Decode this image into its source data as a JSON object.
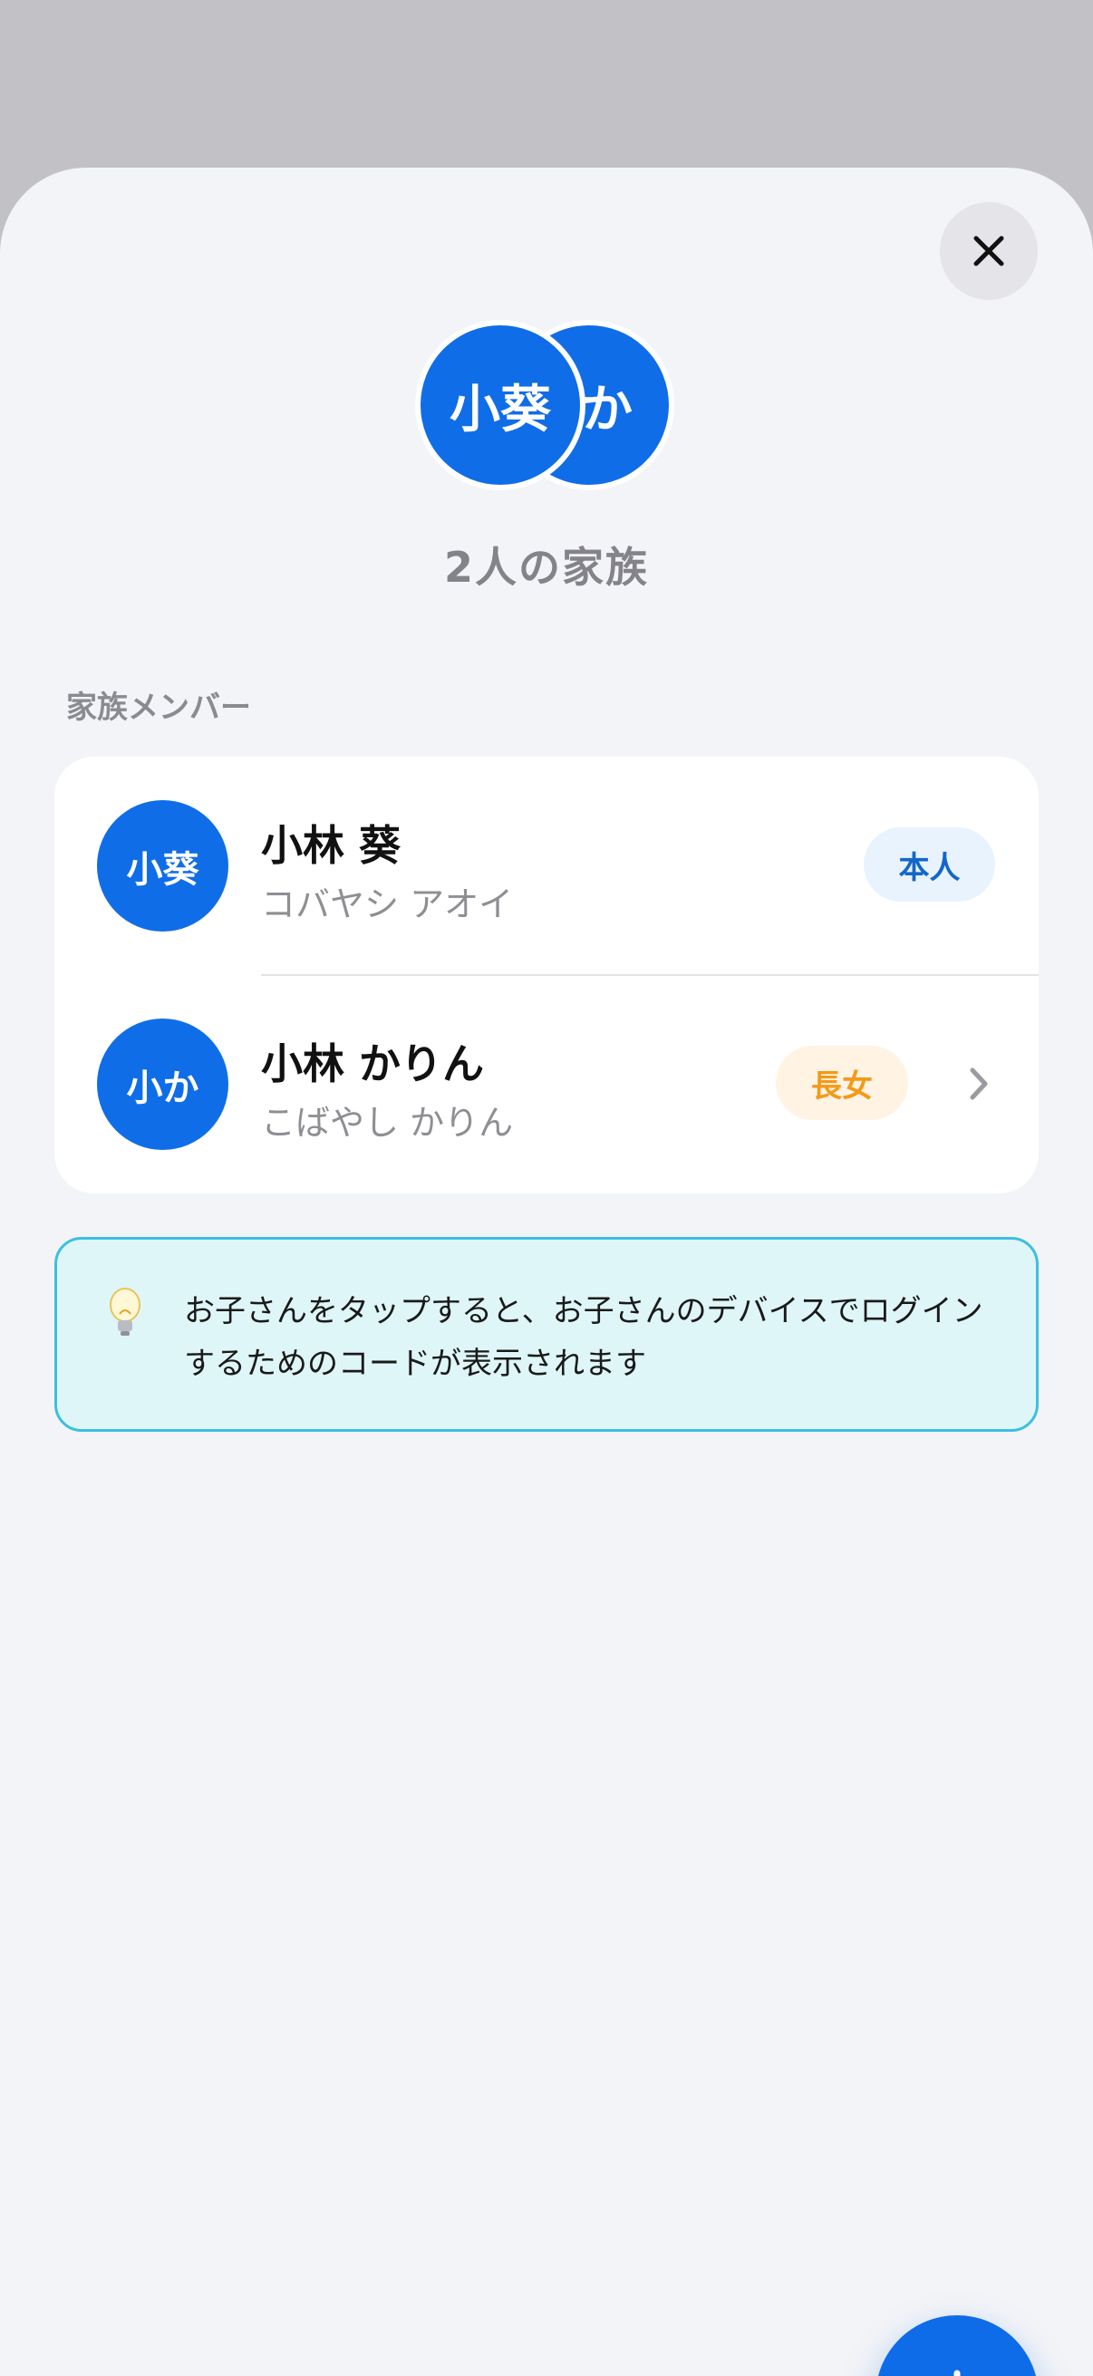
{
  "close_button": {
    "icon": "close-icon"
  },
  "family_header": {
    "avatars": [
      {
        "initials": "小葵"
      },
      {
        "initials": "か"
      }
    ],
    "count_label": "2人の家族"
  },
  "members_section": {
    "label": "家族メンバー",
    "members": [
      {
        "avatar_initials": "小葵",
        "name": "小林 葵",
        "kana": "コバヤシ アオイ",
        "role": "本人",
        "has_chevron": false
      },
      {
        "avatar_initials": "小か",
        "name": "小林 かりん",
        "kana": "こばやし かりん",
        "role": "長女",
        "has_chevron": true
      }
    ]
  },
  "hint": {
    "icon": "lightbulb-icon",
    "text": "お子さんをタップすると、お子さんのデバイスでログインするためのコードが表示されます"
  },
  "fab": {
    "icon": "plus-icon"
  },
  "colors": {
    "accent": "#106de8",
    "self_badge_bg": "#e9f3fe",
    "self_badge_text": "#1467c9",
    "child_badge_bg": "#fff3e3",
    "child_badge_text": "#f39a19",
    "hint_bg": "#dff6f8",
    "hint_border": "#3cbfe0"
  }
}
